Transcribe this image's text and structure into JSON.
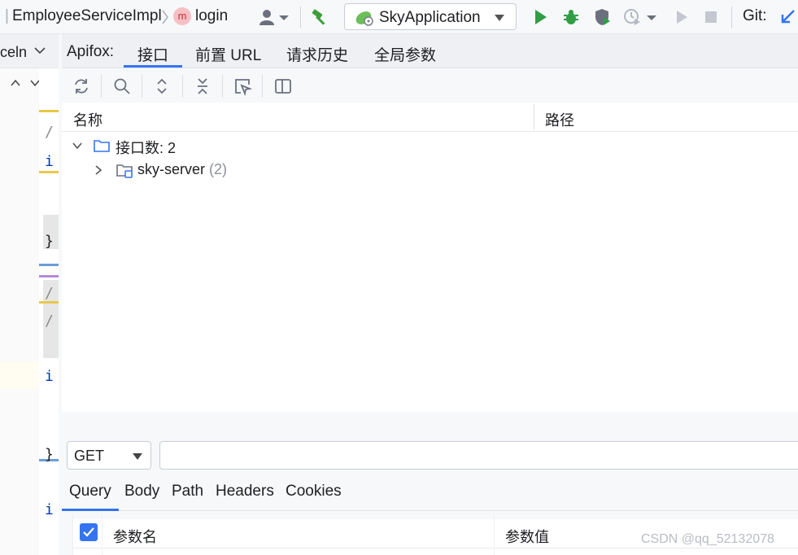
{
  "breadcrumb": {
    "class_name": "EmployeeServiceImpl",
    "method_badge": "m",
    "method_name": "login"
  },
  "run_config": {
    "label": "SkyApplication"
  },
  "vcs": {
    "label": "Git:"
  },
  "editor": {
    "tab_text": "celn"
  },
  "apifox": {
    "title": "Apifox:",
    "tabs": [
      {
        "label": "接口",
        "active": true
      },
      {
        "label": "前置 URL",
        "active": false
      },
      {
        "label": "请求历史",
        "active": false
      },
      {
        "label": "全局参数",
        "active": false
      }
    ],
    "tree": {
      "col_name": "名称",
      "col_path": "路径",
      "root_label": "接口数: 2",
      "children": [
        {
          "label": "sky-server",
          "count": "(2)"
        }
      ]
    },
    "request": {
      "method": "GET",
      "url": "",
      "subtabs": [
        {
          "label": "Query",
          "active": true
        },
        {
          "label": "Body",
          "active": false
        },
        {
          "label": "Path",
          "active": false
        },
        {
          "label": "Headers",
          "active": false
        },
        {
          "label": "Cookies",
          "active": false
        }
      ],
      "params_col_name": "参数名",
      "params_col_value": "参数值"
    }
  },
  "watermark": "CSDN @qq_52132078",
  "colors": {
    "accent": "#3574f0",
    "run_green": "#2f9e44",
    "badge_red": "#c5303a"
  }
}
